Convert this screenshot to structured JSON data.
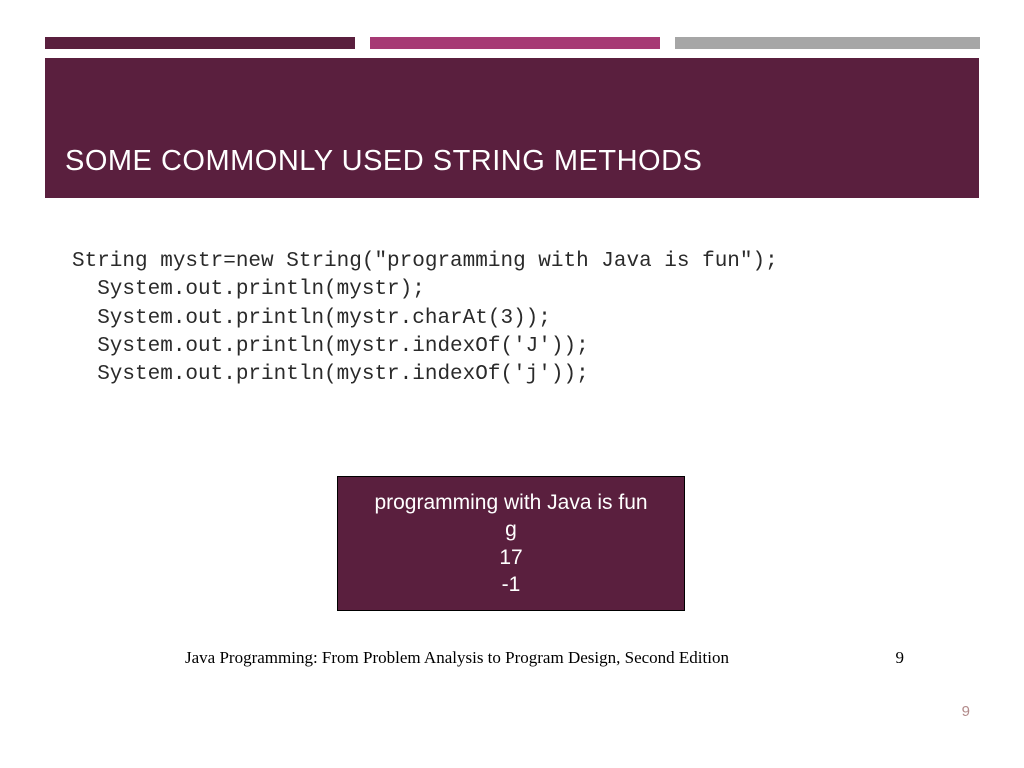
{
  "title": "SOME COMMONLY USED STRING METHODS",
  "code": {
    "line1": "String mystr=new String(\"programming with Java is fun\");",
    "line2": "  System.out.println(mystr);",
    "line3": "  System.out.println(mystr.charAt(3));",
    "line4": "  System.out.println(mystr.indexOf('J'));",
    "line5": "  System.out.println(mystr.indexOf('j'));"
  },
  "output": {
    "line1": "programming with Java is fun",
    "line2": "g",
    "line3": "17",
    "line4": "-1"
  },
  "footer": {
    "citation": "Java Programming: From Problem Analysis to Program Design, Second Edition",
    "page_inline": "9"
  },
  "page_number": "9",
  "colors": {
    "brand_dark": "#5a1f3e",
    "brand_mid": "#a63a74",
    "grey": "#a6a6a6"
  }
}
